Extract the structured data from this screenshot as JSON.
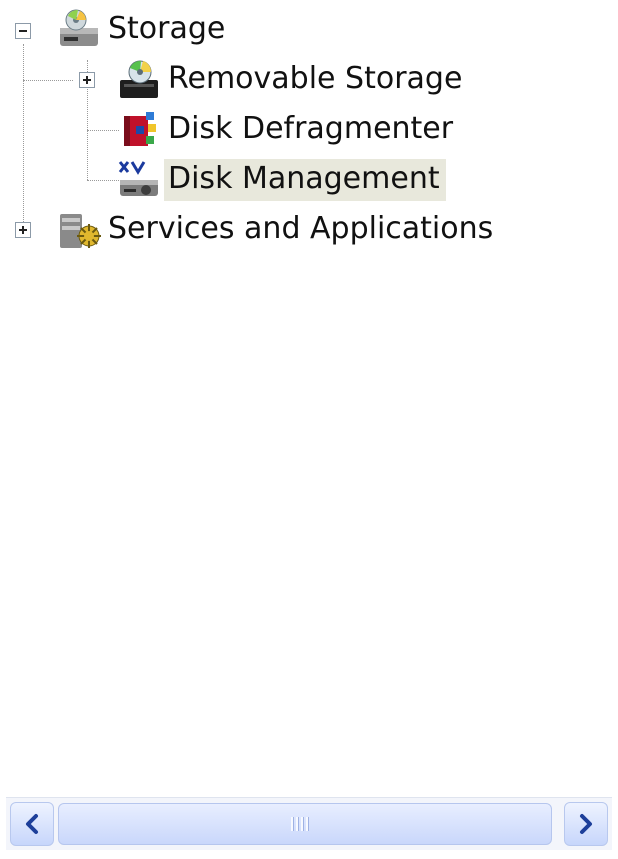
{
  "tree": {
    "storage": {
      "label": "Storage",
      "expanded": true,
      "children": [
        {
          "label": "Removable Storage",
          "has_children": true,
          "icon": "removable-storage-icon"
        },
        {
          "label": "Disk Defragmenter",
          "has_children": false,
          "icon": "disk-defragmenter-icon"
        },
        {
          "label": "Disk Management",
          "has_children": false,
          "selected": true,
          "icon": "disk-management-icon"
        }
      ],
      "icon": "storage-icon"
    },
    "services": {
      "label": "Services and Applications",
      "expanded": false,
      "icon": "services-applications-icon"
    }
  },
  "scrollbar": {
    "orientation": "horizontal",
    "left_arrow": "left-arrow-icon",
    "right_arrow": "right-arrow-icon"
  },
  "colors": {
    "selection_bg": "#e8e8dc",
    "scrollbar_accent": "#c7d6fb",
    "tree_line": "#9a9a9a"
  }
}
